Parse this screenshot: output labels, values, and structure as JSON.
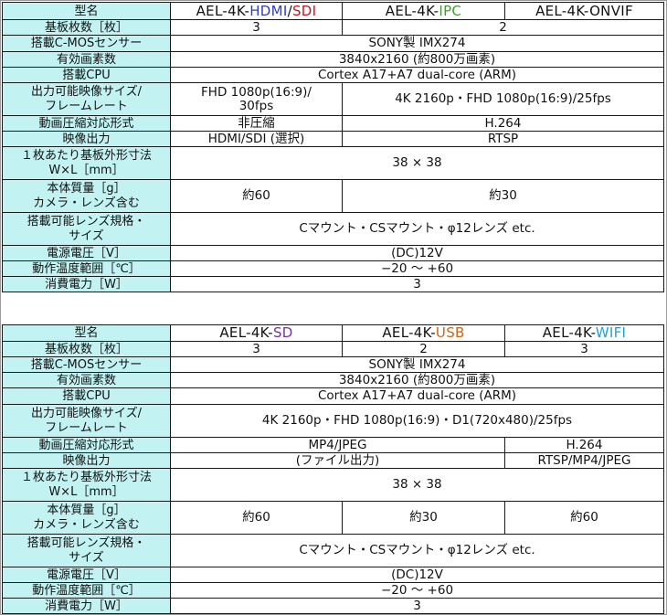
{
  "labels": {
    "model": "型名",
    "boards": "基板枚数［枚］",
    "sensor": "搭載C-MOSセンサー",
    "pixels": "有効画素数",
    "cpu": "搭載CPU",
    "output_size_1": "出力可能映像サイズ/",
    "output_size_2": "フレームレート",
    "codec": "動画圧縮対応形式",
    "video_out": "映像出力",
    "board_size_1": "１枚あたり基板外形寸法",
    "board_size_2": "W×L［mm］",
    "weight_1": "本体質量［g］",
    "weight_2": "カメラ・レンズ含む",
    "lens_1": "搭載可能レンズ規格・",
    "lens_2": "サイズ",
    "voltage": "電源電圧［V］",
    "temp": "動作温度範囲［℃］",
    "power": "消費電力［W］"
  },
  "table1": {
    "models": [
      {
        "prefix": "AEL-4K-",
        "suffix_a": "HDMI",
        "sep": "/",
        "suffix_b": "SDI"
      },
      {
        "prefix": "AEL-4K-",
        "suffix": "IPC"
      },
      {
        "prefix": "AEL-4K-",
        "suffix": "ONVIF"
      }
    ],
    "boards": [
      "3",
      "2"
    ],
    "sensor": "SONY製 IMX274",
    "pixels": "3840x2160 (約800万画素)",
    "cpu": "Cortex A17+A7 dual-core (ARM)",
    "output_size": {
      "col1_line1": "FHD 1080p(16:9)/",
      "col1_line2": "30fps",
      "col23": "4K 2160p・FHD 1080p(16:9)/25fps"
    },
    "codec": [
      "非圧縮",
      "H.264"
    ],
    "video_out": [
      "HDMI/SDI (選択)",
      "RTSP"
    ],
    "board_size": "38 × 38",
    "weight": [
      "約60",
      "約30"
    ],
    "lens": "Cマウント・CSマウント・φ12レンズ etc.",
    "voltage": "(DC)12V",
    "temp": "−20 ～ +60",
    "power": "3"
  },
  "table2": {
    "models": [
      {
        "prefix": "AEL-4K-",
        "suffix": "SD"
      },
      {
        "prefix": "AEL-4K-",
        "suffix": "USB"
      },
      {
        "prefix": "AEL-4K-",
        "suffix": "WIFI"
      }
    ],
    "boards": [
      "3",
      "2",
      "3"
    ],
    "sensor": "SONY製 IMX274",
    "pixels": "3840x2160 (約800万画素)",
    "cpu": "Cortex A17+A7 dual-core (ARM)",
    "output_size": "4K 2160p・FHD 1080p(16:9)・D1(720x480)/25fps",
    "codec": [
      "MP4/JPEG",
      "H.264"
    ],
    "video_out": [
      "(ファイル出力)",
      "RTSP/MP4/JPEG"
    ],
    "board_size": "38 × 38",
    "weight": [
      "約60",
      "約30",
      "約60"
    ],
    "lens": "Cマウント・CSマウント・φ12レンズ etc.",
    "voltage": "(DC)12V",
    "temp": "−20 ～ +60",
    "power": "3"
  },
  "colors": {
    "label_bg": "#c2f2f2",
    "hdmi": "#2b3fc2",
    "sdi": "#d10f1c",
    "ipc": "#3f9d2a",
    "sd": "#7a2fa0",
    "usb": "#d0650f",
    "wifi": "#1fa2d6"
  }
}
